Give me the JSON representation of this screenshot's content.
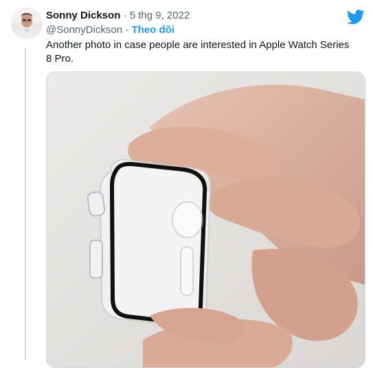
{
  "tweet": {
    "display_name": "Sonny Dickson",
    "separator": " · ",
    "date": "5 thg 9, 2022",
    "handle": "@SonnyDickson",
    "follow_label": "Theo dõi",
    "text": "Another photo in case people are interested in Apple Watch Series 8 Pro."
  },
  "icons": {
    "brand": "twitter-bird-icon",
    "avatar": "profile-photo"
  },
  "colors": {
    "accent": "#1d9bf0",
    "text": "#0f1419",
    "muted": "#536471",
    "border": "#cfd9de"
  }
}
